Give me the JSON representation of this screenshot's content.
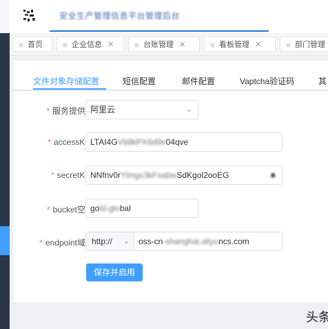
{
  "header": {
    "title": "安全生产管理信息平台管理后台"
  },
  "tags": [
    {
      "label": "首页",
      "closable": false
    },
    {
      "label": "企业信息",
      "closable": true
    },
    {
      "label": "台账管理",
      "closable": true
    },
    {
      "label": "看板管理",
      "closable": true
    },
    {
      "label": "部门管理",
      "closable": false
    }
  ],
  "tabs": [
    {
      "label": "文件对象存储配置",
      "active": true
    },
    {
      "label": "短信配置",
      "active": false
    },
    {
      "label": "邮件配置",
      "active": false
    },
    {
      "label": "Vaptcha验证码",
      "active": false
    },
    {
      "label": "其",
      "active": false
    }
  ],
  "form": {
    "provider": {
      "label": "服务提供商",
      "value": "阿里云"
    },
    "access_key": {
      "label": "accessKey",
      "value_start": "LTAI4G",
      "value_end": "04qve"
    },
    "secret_key": {
      "label": "secretKey",
      "value_start": "NNfnv0r",
      "value_end": "SdKgol2ooEG"
    },
    "bucket": {
      "label": "bucket空间",
      "value_start": "go",
      "value_end": "bal"
    },
    "endpoint": {
      "label": "endpoint域名",
      "protocol": "http://",
      "value_start": "oss-cn",
      "value_end": "ncs.com"
    },
    "submit_label": "保存并启用"
  },
  "watermark": "头条"
}
